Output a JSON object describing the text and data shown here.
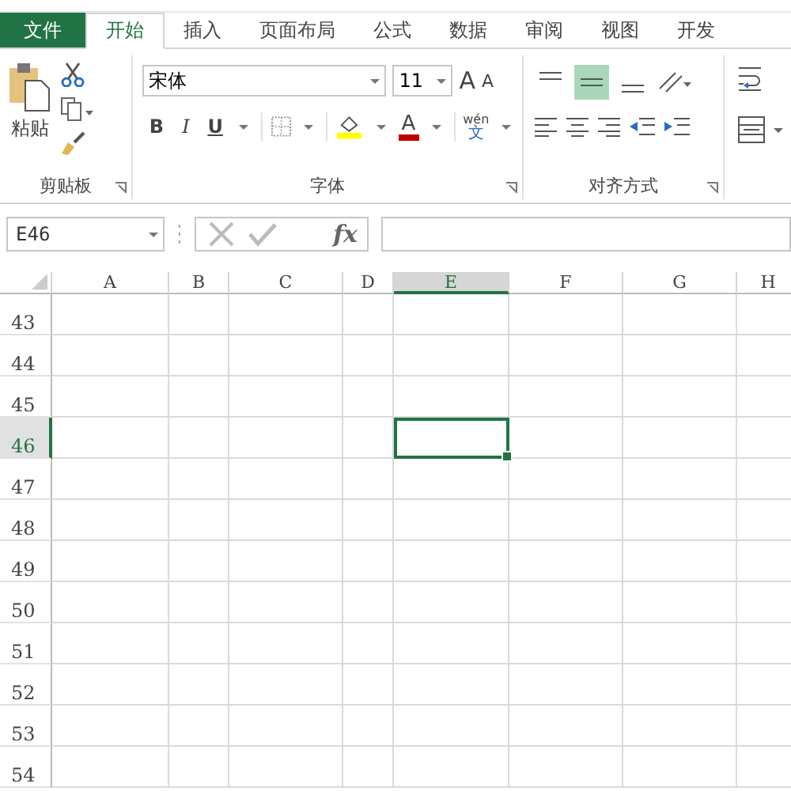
{
  "tabs": [
    {
      "label": "文件",
      "kind": "file",
      "selected": false
    },
    {
      "label": "开始",
      "kind": "tab",
      "selected": true
    },
    {
      "label": "插入",
      "kind": "tab",
      "selected": false
    },
    {
      "label": "页面布局",
      "kind": "tab",
      "selected": false
    },
    {
      "label": "公式",
      "kind": "tab",
      "selected": false
    },
    {
      "label": "数据",
      "kind": "tab",
      "selected": false
    },
    {
      "label": "审阅",
      "kind": "tab",
      "selected": false
    },
    {
      "label": "视图",
      "kind": "tab",
      "selected": false
    },
    {
      "label": "开发",
      "kind": "tab",
      "selected": false
    }
  ],
  "ribbon": {
    "clipboard": {
      "paste": "粘贴",
      "label": "剪贴板"
    },
    "font": {
      "name": "宋体",
      "size": "11",
      "grow": "A",
      "shrink": "A",
      "bold": "B",
      "italic": "I",
      "underline": "U",
      "font_color": "A",
      "phonetic_top": "wén",
      "phonetic_bottom": "文",
      "label": "字体"
    },
    "alignment": {
      "vertical": [
        {
          "kind": "top",
          "selected": false
        },
        {
          "kind": "middle",
          "selected": true
        },
        {
          "kind": "bottom",
          "selected": false
        }
      ],
      "label": "对齐方式"
    }
  },
  "formula_bar": {
    "name_box": "E46",
    "fx": "fx"
  },
  "sheet": {
    "columns": [
      {
        "label": "A",
        "selected": false
      },
      {
        "label": "B",
        "selected": false
      },
      {
        "label": "C",
        "selected": false
      },
      {
        "label": "D",
        "selected": false
      },
      {
        "label": "E",
        "selected": true
      },
      {
        "label": "F",
        "selected": false
      },
      {
        "label": "G",
        "selected": false
      },
      {
        "label": "H",
        "selected": false
      }
    ],
    "rows": [
      {
        "label": "43",
        "selected": false
      },
      {
        "label": "44",
        "selected": false
      },
      {
        "label": "45",
        "selected": false
      },
      {
        "label": "46",
        "selected": true
      },
      {
        "label": "47",
        "selected": false
      },
      {
        "label": "48",
        "selected": false
      },
      {
        "label": "49",
        "selected": false
      },
      {
        "label": "50",
        "selected": false
      },
      {
        "label": "51",
        "selected": false
      },
      {
        "label": "52",
        "selected": false
      },
      {
        "label": "53",
        "selected": false
      },
      {
        "label": "54",
        "selected": false
      }
    ]
  }
}
